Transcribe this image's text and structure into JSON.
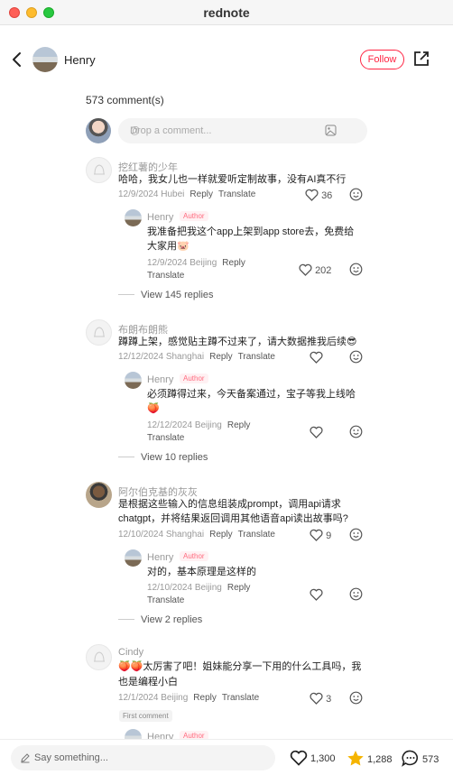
{
  "window": {
    "title": "rednote"
  },
  "header": {
    "user_name": "Henry",
    "follow_label": "Follow"
  },
  "comments_count": "573 comment(s)",
  "input": {
    "placeholder": "Drop a comment..."
  },
  "comments": [
    {
      "user": "挖红薯的少年",
      "text_line1": "哈哈，我女儿也一样就爱听定制故事，没有AI真不行",
      "text_line2": "",
      "date_loc": "12/9/2024 Hubei",
      "reply": "Reply",
      "translate": "Translate",
      "likes": "36",
      "sub": {
        "user": "Henry",
        "badge": "Author",
        "text_line1": "我准备把我这个app上架到app store去，免费给",
        "text_line2": "大家用🐷",
        "date_loc": "12/9/2024 Beijing",
        "reply": "Reply",
        "translate": "Translate",
        "likes": "202"
      },
      "view": "View 145 replies"
    },
    {
      "user": "布朗布朗熊",
      "text_line1": "蹲蹲上架，感觉贴主蹲不过来了，请大数据推我后续😎",
      "text_line2": "",
      "date_loc": "12/12/2024 Shanghai",
      "reply": "Reply",
      "translate": "Translate",
      "likes": "",
      "sub": {
        "user": "Henry",
        "badge": "Author",
        "text_line1": "必须蹲得过来，今天备案通过，宝子等我上线哈",
        "text_line2": "🍑",
        "date_loc": "12/12/2024 Beijing",
        "reply": "Reply",
        "translate": "Translate",
        "likes": ""
      },
      "view": "View 10 replies"
    },
    {
      "user": "阿尔伯克基的灰灰",
      "text_line1": "是根据这些输入的信息组装成prompt，调用api请求",
      "text_line2": "chatgpt，并将结果返回调用其他语音api读出故事吗?",
      "date_loc": "12/10/2024 Shanghai",
      "reply": "Reply",
      "translate": "Translate",
      "likes": "9",
      "sub": {
        "user": "Henry",
        "badge": "Author",
        "text_line1": "对的，基本原理是这样的",
        "text_line2": "",
        "date_loc": "12/10/2024 Beijing",
        "reply": "Reply",
        "translate": "Translate",
        "likes": ""
      },
      "view": "View 2 replies"
    },
    {
      "user": "Cindy",
      "text_line1": "🍑🍑太厉害了吧！姐妹能分享一下用的什么工具吗，我",
      "text_line2": "也是编程小白",
      "date_loc": "12/1/2024 Beijing",
      "reply": "Reply",
      "translate": "Translate",
      "likes": "3",
      "first_badge": "First comment",
      "sub": {
        "user": "Henry",
        "badge": "Author"
      }
    }
  ],
  "bottom": {
    "say_placeholder": "Say something...",
    "likes": "1,300",
    "stars": "1,288",
    "comments": "573"
  },
  "colors": {
    "accent": "#ff2442",
    "star": "#f5b400"
  }
}
